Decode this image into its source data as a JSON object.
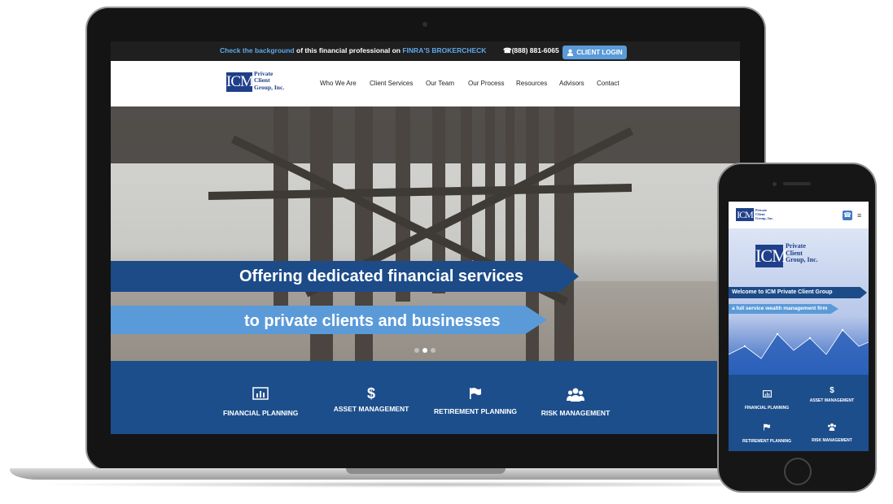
{
  "topbar": {
    "check_prefix": "Check the background",
    "check_middle": " of this financial professional on ",
    "check_link": "FINRA'S BROKERCHECK",
    "phone": "(888) 881-6065",
    "login_label": "CLIENT LOGIN"
  },
  "logo": {
    "mark": "ICM",
    "line1": "Private",
    "line2": "Client",
    "line3": "Group, Inc."
  },
  "nav": [
    "Who We Are",
    "Client Services",
    "Our Team",
    "Our Process",
    "Resources",
    "Advisors",
    "Contact"
  ],
  "hero": {
    "line1": "Offering dedicated financial services",
    "line2": "to private clients and businesses",
    "slide_count": 3,
    "active_slide": 2
  },
  "services": [
    {
      "label": "FINANCIAL PLANNING",
      "icon": "bar-chart-icon"
    },
    {
      "label": "ASSET MANAGEMENT",
      "icon": "dollar-icon"
    },
    {
      "label": "RETIREMENT PLANNING",
      "icon": "flag-icon"
    },
    {
      "label": "RISK MANAGEMENT",
      "icon": "users-icon"
    }
  ],
  "mobile": {
    "welcome": "Welcome to ICM Private Client Group",
    "tagline": "a full service wealth management firm"
  },
  "colors": {
    "brand_blue": "#1f3f8a",
    "band_blue": "#1d4e8c",
    "light_blue": "#5b9ad8",
    "topbar": "#1f1f1f"
  }
}
